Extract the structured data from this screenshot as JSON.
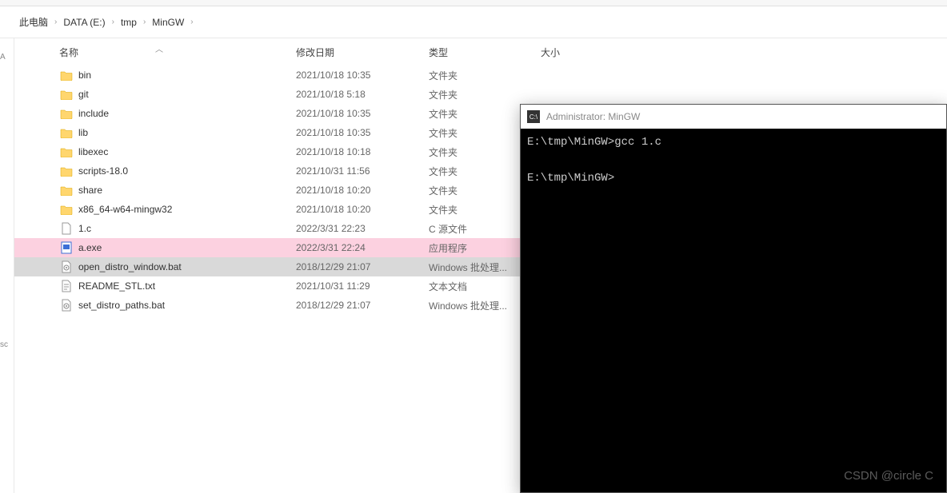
{
  "breadcrumb": {
    "items": [
      "此电脑",
      "DATA (E:)",
      "tmp",
      "MinGW"
    ]
  },
  "columns": {
    "name": "名称",
    "date": "修改日期",
    "type": "类型",
    "size": "大小"
  },
  "left_strip": {
    "top": "A",
    "bottom": "sc"
  },
  "files": [
    {
      "icon": "folder",
      "name": "bin",
      "date": "2021/10/18 10:35",
      "type": "文件夹",
      "hl": false,
      "sel": false
    },
    {
      "icon": "folder",
      "name": "git",
      "date": "2021/10/18 5:18",
      "type": "文件夹",
      "hl": false,
      "sel": false
    },
    {
      "icon": "folder",
      "name": "include",
      "date": "2021/10/18 10:35",
      "type": "文件夹",
      "hl": false,
      "sel": false
    },
    {
      "icon": "folder",
      "name": "lib",
      "date": "2021/10/18 10:35",
      "type": "文件夹",
      "hl": false,
      "sel": false
    },
    {
      "icon": "folder",
      "name": "libexec",
      "date": "2021/10/18 10:18",
      "type": "文件夹",
      "hl": false,
      "sel": false
    },
    {
      "icon": "folder",
      "name": "scripts-18.0",
      "date": "2021/10/31 11:56",
      "type": "文件夹",
      "hl": false,
      "sel": false
    },
    {
      "icon": "folder",
      "name": "share",
      "date": "2021/10/18 10:20",
      "type": "文件夹",
      "hl": false,
      "sel": false
    },
    {
      "icon": "folder",
      "name": "x86_64-w64-mingw32",
      "date": "2021/10/18 10:20",
      "type": "文件夹",
      "hl": false,
      "sel": false
    },
    {
      "icon": "file",
      "name": "1.c",
      "date": "2022/3/31 22:23",
      "type": "C 源文件",
      "hl": false,
      "sel": false
    },
    {
      "icon": "exe",
      "name": "a.exe",
      "date": "2022/3/31 22:24",
      "type": "应用程序",
      "hl": true,
      "sel": false
    },
    {
      "icon": "bat",
      "name": "open_distro_window.bat",
      "date": "2018/12/29 21:07",
      "type": "Windows 批处理...",
      "hl": false,
      "sel": true
    },
    {
      "icon": "txt",
      "name": "README_STL.txt",
      "date": "2021/10/31 11:29",
      "type": "文本文档",
      "hl": false,
      "sel": false
    },
    {
      "icon": "bat",
      "name": "set_distro_paths.bat",
      "date": "2018/12/29 21:07",
      "type": "Windows 批处理...",
      "hl": false,
      "sel": false
    }
  ],
  "terminal": {
    "title": "Administrator:  MinGW",
    "lines": [
      "E:\\tmp\\MinGW>gcc 1.c",
      "",
      "E:\\tmp\\MinGW>"
    ]
  },
  "watermark": "CSDN @circle C"
}
